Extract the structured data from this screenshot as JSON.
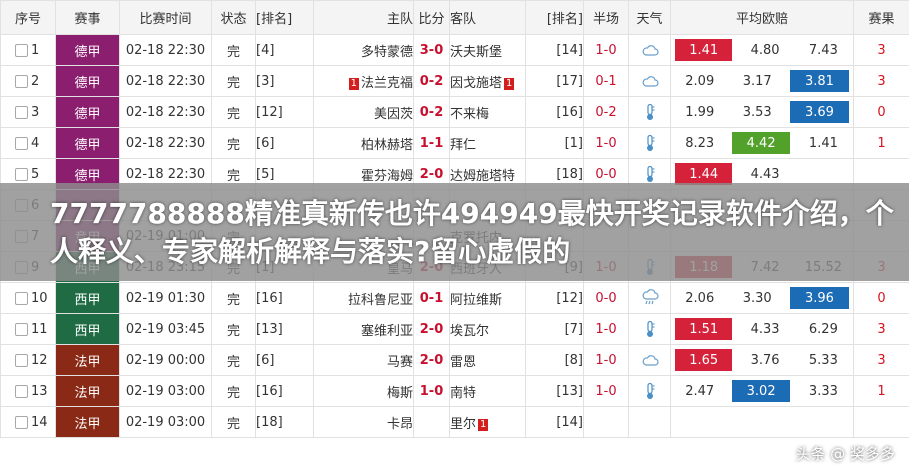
{
  "headers": {
    "seq": "序号",
    "league": "赛事",
    "time": "比赛时间",
    "status": "状态",
    "home_rank": "[排名]",
    "home": "主队",
    "score": "比分",
    "away": "客队",
    "away_rank": "[排名]",
    "half": "半场",
    "weather": "天气",
    "odds": "平均欧赔",
    "cards": "赛果"
  },
  "rows": [
    {
      "seq": "1",
      "league": "德甲",
      "league_class": "lg-dejia",
      "time": "02-18 22:30",
      "status": "完",
      "home_rank": "[4]",
      "home": "多特蒙德",
      "home_red": "",
      "score": "3-0",
      "away": "沃夫斯堡",
      "away_red": "",
      "away_rank": "[14]",
      "half": "1-0",
      "weather": "cloud",
      "o1": "1.41",
      "o1c": "red",
      "o2": "4.80",
      "o2c": "",
      "o3": "7.43",
      "o3c": "",
      "cards": "3"
    },
    {
      "seq": "2",
      "league": "德甲",
      "league_class": "lg-dejia",
      "time": "02-18 22:30",
      "status": "完",
      "home_rank": "[3]",
      "home": "法兰克福",
      "home_red": "1",
      "score": "0-2",
      "away": "因戈施塔",
      "away_red": "1",
      "away_rank": "[17]",
      "half": "0-1",
      "weather": "cloud",
      "o1": "2.09",
      "o1c": "",
      "o2": "3.17",
      "o2c": "",
      "o3": "3.81",
      "o3c": "blue",
      "cards": "3"
    },
    {
      "seq": "3",
      "league": "德甲",
      "league_class": "lg-dejia",
      "time": "02-18 22:30",
      "status": "完",
      "home_rank": "[12]",
      "home": "美因茨",
      "home_red": "",
      "score": "0-2",
      "away": "不来梅",
      "away_red": "",
      "away_rank": "[16]",
      "half": "0-2",
      "weather": "thermo",
      "o1": "1.99",
      "o1c": "",
      "o2": "3.53",
      "o2c": "",
      "o3": "3.69",
      "o3c": "blue",
      "cards": "0"
    },
    {
      "seq": "4",
      "league": "德甲",
      "league_class": "lg-dejia",
      "time": "02-18 22:30",
      "status": "完",
      "home_rank": "[6]",
      "home": "柏林赫塔",
      "home_red": "",
      "score": "1-1",
      "away": "拜仁",
      "away_red": "",
      "away_rank": "[1]",
      "half": "1-0",
      "weather": "thermo",
      "o1": "8.23",
      "o1c": "",
      "o2": "4.42",
      "o2c": "green",
      "o3": "1.41",
      "o3c": "",
      "cards": "1"
    },
    {
      "seq": "5",
      "league": "德甲",
      "league_class": "lg-dejia",
      "time": "02-18 22:30",
      "status": "完",
      "home_rank": "[5]",
      "home": "霍芬海姆",
      "home_red": "",
      "score": "2-0",
      "away": "达姆施塔特",
      "away_red": "",
      "away_rank": "[18]",
      "half": "0-0",
      "weather": "thermo",
      "o1": "1.44",
      "o1c": "red",
      "o2": "4.43",
      "o2c": "",
      "o3": "",
      "o3c": "",
      "cards": ""
    },
    {
      "seq": "6",
      "league": "",
      "league_class": "lg-dejia",
      "time": "",
      "status": "",
      "home_rank": "",
      "home": "",
      "home_red": "",
      "score": "",
      "away": "",
      "away_red": "",
      "away_rank": "",
      "half": "",
      "weather": "",
      "o1": "",
      "o1c": "",
      "o2": "",
      "o2c": "",
      "o3": "",
      "o3c": "",
      "cards": ""
    },
    {
      "seq": "7",
      "league": "意甲",
      "league_class": "lg-dejia",
      "time": "02-19 01:00",
      "status": "完",
      "home_rank": "",
      "home": "",
      "home_red": "",
      "score": "",
      "away": "克罗托内",
      "away_red": "",
      "away_rank": "",
      "half": "",
      "weather": "",
      "o1": "",
      "o1c": "",
      "o2": "",
      "o2c": "",
      "o3": "",
      "o3c": "",
      "cards": ""
    },
    {
      "seq": "9",
      "league": "西甲",
      "league_class": "lg-xijia",
      "time": "02-18 23:15",
      "status": "完",
      "home_rank": "[1]",
      "home": "皇马",
      "home_red": "",
      "score": "2-0",
      "away": "西班牙人",
      "away_red": "",
      "away_rank": "[9]",
      "half": "1-0",
      "weather": "thermo",
      "o1": "1.18",
      "o1c": "red",
      "o2": "7.42",
      "o2c": "",
      "o3": "15.52",
      "o3c": "",
      "cards": "3"
    },
    {
      "seq": "10",
      "league": "西甲",
      "league_class": "lg-xijia",
      "time": "02-19 01:30",
      "status": "完",
      "home_rank": "[16]",
      "home": "拉科鲁尼亚",
      "home_red": "",
      "score": "0-1",
      "away": "阿拉维斯",
      "away_red": "",
      "away_rank": "[12]",
      "half": "0-0",
      "weather": "rain",
      "o1": "2.06",
      "o1c": "",
      "o2": "3.30",
      "o2c": "",
      "o3": "3.96",
      "o3c": "blue",
      "cards": "0"
    },
    {
      "seq": "11",
      "league": "西甲",
      "league_class": "lg-xijia",
      "time": "02-19 03:45",
      "status": "完",
      "home_rank": "[13]",
      "home": "塞维利亚",
      "home_red": "",
      "score": "2-0",
      "away": "埃瓦尔",
      "away_red": "",
      "away_rank": "[7]",
      "half": "1-0",
      "weather": "thermo",
      "o1": "1.51",
      "o1c": "red",
      "o2": "4.33",
      "o2c": "",
      "o3": "6.29",
      "o3c": "",
      "cards": "3"
    },
    {
      "seq": "12",
      "league": "法甲",
      "league_class": "lg-fajia",
      "time": "02-19 00:00",
      "status": "完",
      "home_rank": "[6]",
      "home": "马赛",
      "home_red": "",
      "score": "2-0",
      "away": "雷恩",
      "away_red": "",
      "away_rank": "[8]",
      "half": "1-0",
      "weather": "cloud",
      "o1": "1.65",
      "o1c": "red",
      "o2": "3.76",
      "o2c": "",
      "o3": "5.33",
      "o3c": "",
      "cards": "3"
    },
    {
      "seq": "13",
      "league": "法甲",
      "league_class": "lg-fajia",
      "time": "02-19 03:00",
      "status": "完",
      "home_rank": "[16]",
      "home": "梅斯",
      "home_red": "",
      "score": "1-0",
      "away": "南特",
      "away_red": "",
      "away_rank": "[13]",
      "half": "1-0",
      "weather": "thermo",
      "o1": "2.47",
      "o1c": "",
      "o2": "3.02",
      "o2c": "blue",
      "o3": "3.33",
      "o3c": "",
      "cards": "1"
    },
    {
      "seq": "14",
      "league": "法甲",
      "league_class": "lg-fajia",
      "time": "02-19 03:00",
      "status": "完",
      "home_rank": "[18]",
      "home": "卡昂",
      "home_red": "",
      "score": "",
      "away": "里尔",
      "away_red": "1",
      "away_rank": "[14]",
      "half": "",
      "weather": "",
      "o1": "",
      "o1c": "",
      "o2": "",
      "o2c": "",
      "o3": "",
      "o3c": "",
      "cards": ""
    }
  ],
  "banner": "7777788888精准真新传也许494949最快开奖记录软件介绍，个人释义、专家解析解释与落实?留心虚假的",
  "watermark": "头条 @ 奖多多",
  "colors": {
    "league_dejia": "#8b1e6e",
    "league_xijia": "#1e6b44",
    "league_fajia": "#8a2a16",
    "score": "#c8102e",
    "odd_red": "#d6213a",
    "odd_blue": "#1b6bb5",
    "odd_green": "#52a12a"
  }
}
